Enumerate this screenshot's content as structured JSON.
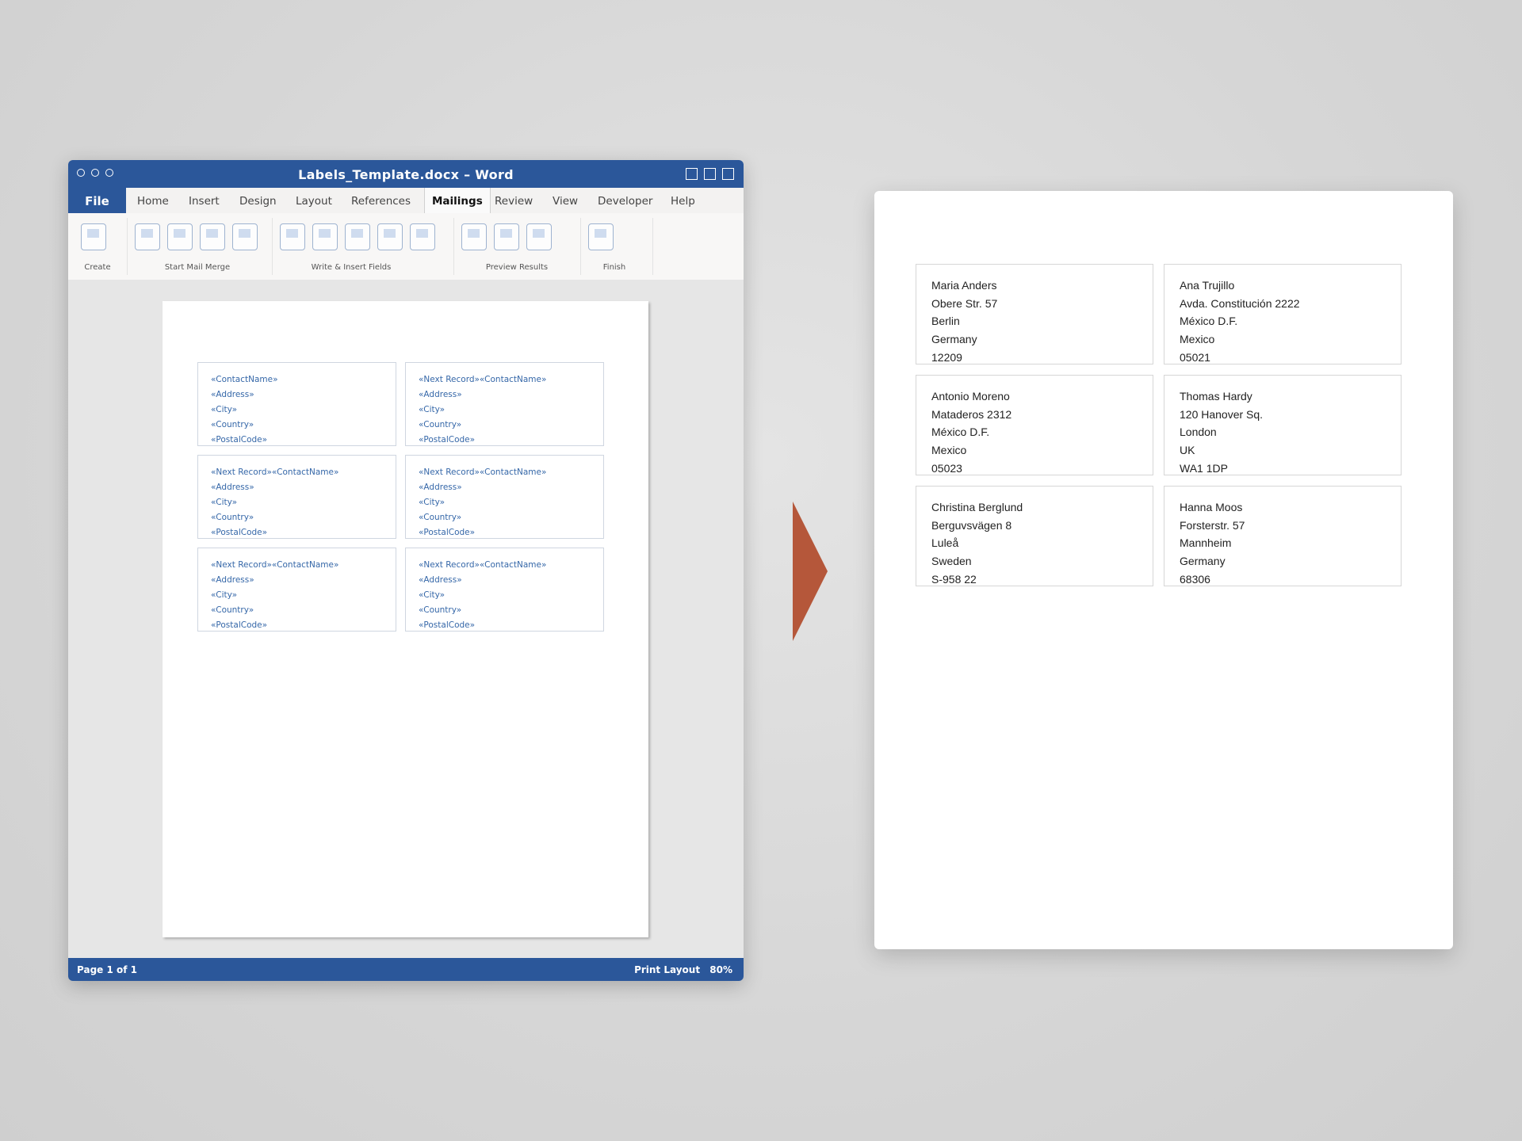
{
  "window": {
    "title": "Labels_Template.docx – Word",
    "tabs": {
      "file": "File",
      "items": [
        "Home",
        "Insert",
        "Design",
        "Layout",
        "References",
        "Mailings",
        "Review",
        "View",
        "Developer",
        "Help"
      ],
      "active": "Mailings"
    },
    "ribbon_groups": [
      "Create",
      "Start Mail Merge",
      "Write & Insert Fields",
      "Preview Results",
      "Finish"
    ],
    "status": {
      "page": "Page 1 of 1",
      "view": "Print Layout",
      "zoom": "80%"
    }
  },
  "template_labels": [
    [
      "«ContactName»",
      "«Address»",
      "«City»",
      "«Country»",
      "«PostalCode»"
    ],
    [
      "«Next Record»«ContactName»",
      "«Address»",
      "«City»",
      "«Country»",
      "«PostalCode»"
    ],
    [
      "«Next Record»«ContactName»",
      "«Address»",
      "«City»",
      "«Country»",
      "«PostalCode»"
    ],
    [
      "«Next Record»«ContactName»",
      "«Address»",
      "«City»",
      "«Country»",
      "«PostalCode»"
    ],
    [
      "«Next Record»«ContactName»",
      "«Address»",
      "«City»",
      "«Country»",
      "«PostalCode»"
    ],
    [
      "«Next Record»«ContactName»",
      "«Address»",
      "«City»",
      "«Country»",
      "«PostalCode»"
    ]
  ],
  "result_labels": [
    [
      "Maria Anders",
      "Obere Str. 57",
      "Berlin",
      "Germany",
      "12209"
    ],
    [
      "Ana Trujillo",
      "Avda. Constitución 2222",
      "México D.F.",
      "Mexico",
      "05021"
    ],
    [
      "Antonio Moreno",
      "Mataderos 2312",
      "México D.F.",
      "Mexico",
      "05023"
    ],
    [
      "Thomas Hardy",
      "120 Hanover Sq.",
      "London",
      "UK",
      "WA1 1DP"
    ],
    [
      "Christina Berglund",
      "Berguvsvägen 8",
      "Luleå",
      "Sweden",
      "S-958 22"
    ],
    [
      "Hanna Moos",
      "Forsterstr. 57",
      "Mannheim",
      "Germany",
      "68306"
    ]
  ],
  "colors": {
    "word_blue": "#2b579a",
    "merge_field": "#3567a8",
    "arrow": "#b5573a"
  }
}
